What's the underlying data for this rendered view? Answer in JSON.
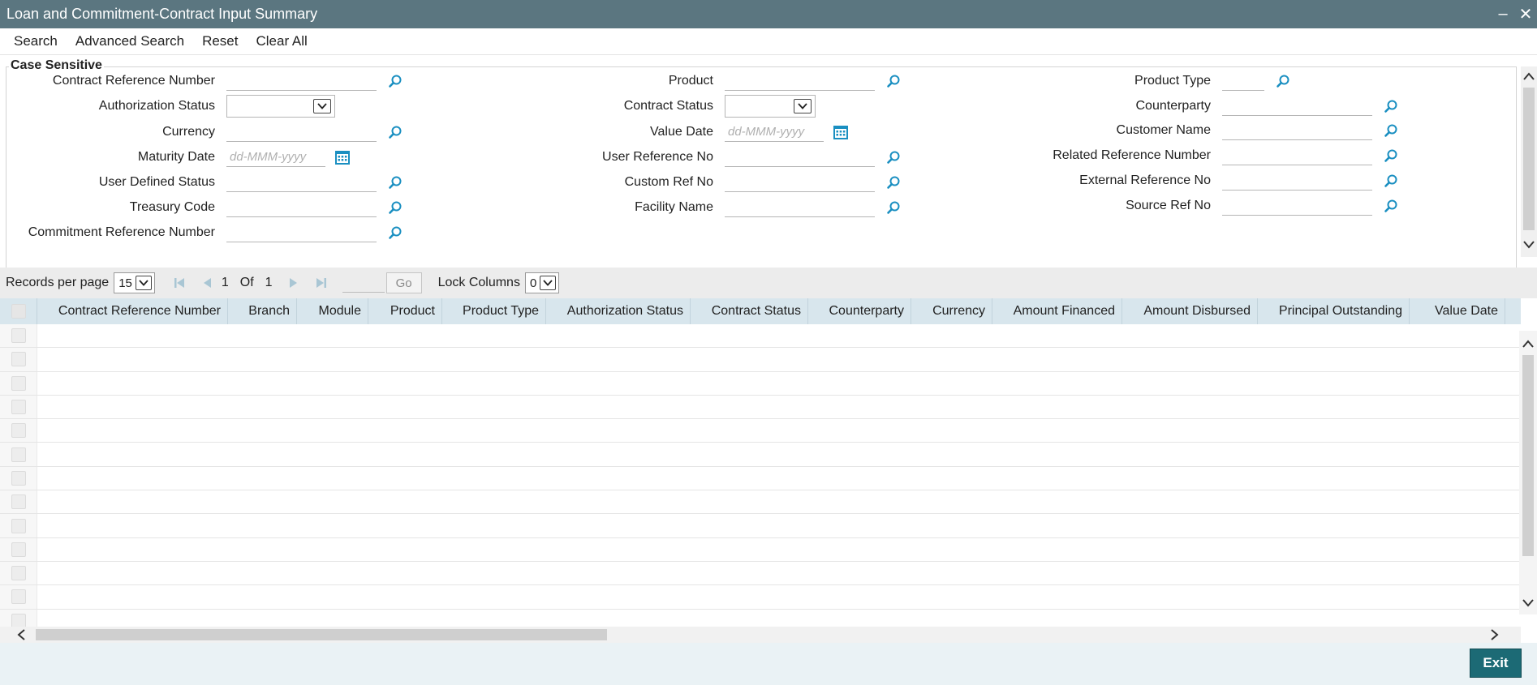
{
  "window": {
    "title": "Loan and Commitment-Contract Input Summary",
    "minimize_glyph": "‒",
    "close_glyph": "✕"
  },
  "toolbar": {
    "search": "Search",
    "advanced_search": "Advanced Search",
    "reset": "Reset",
    "clear_all": "Clear All"
  },
  "search": {
    "legend": "Case Sensitive",
    "date_placeholder": "dd-MMM-yyyy",
    "labels": {
      "contract_ref": "Contract Reference Number",
      "auth_status": "Authorization Status",
      "currency": "Currency",
      "maturity_date": "Maturity Date",
      "user_defined_status": "User Defined Status",
      "treasury_code": "Treasury Code",
      "commitment_ref": "Commitment Reference Number",
      "product": "Product",
      "contract_status": "Contract Status",
      "value_date": "Value Date",
      "user_ref_no": "User Reference No",
      "custom_ref_no": "Custom Ref No",
      "facility_name": "Facility Name",
      "product_type": "Product Type",
      "counterparty": "Counterparty",
      "customer_name": "Customer Name",
      "related_ref": "Related Reference Number",
      "external_ref": "External Reference No",
      "source_ref": "Source Ref No"
    }
  },
  "pager": {
    "records_label": "Records per page",
    "records_value": "15",
    "page_current": "1",
    "of_label": "Of",
    "page_total": "1",
    "go_label": "Go",
    "lock_label": "Lock Columns",
    "lock_value": "0"
  },
  "grid": {
    "columns": [
      "Contract Reference Number",
      "Branch",
      "Module",
      "Product",
      "Product Type",
      "Authorization Status",
      "Contract Status",
      "Counterparty",
      "Currency",
      "Amount Financed",
      "Amount Disbursed",
      "Principal Outstanding",
      "Value Date"
    ]
  },
  "footer": {
    "exit": "Exit"
  },
  "colors": {
    "titlebar": "#5b7680",
    "accent": "#1a8fc1",
    "exit_button": "#1c6a75",
    "grid_header": "#d8e6ed"
  }
}
